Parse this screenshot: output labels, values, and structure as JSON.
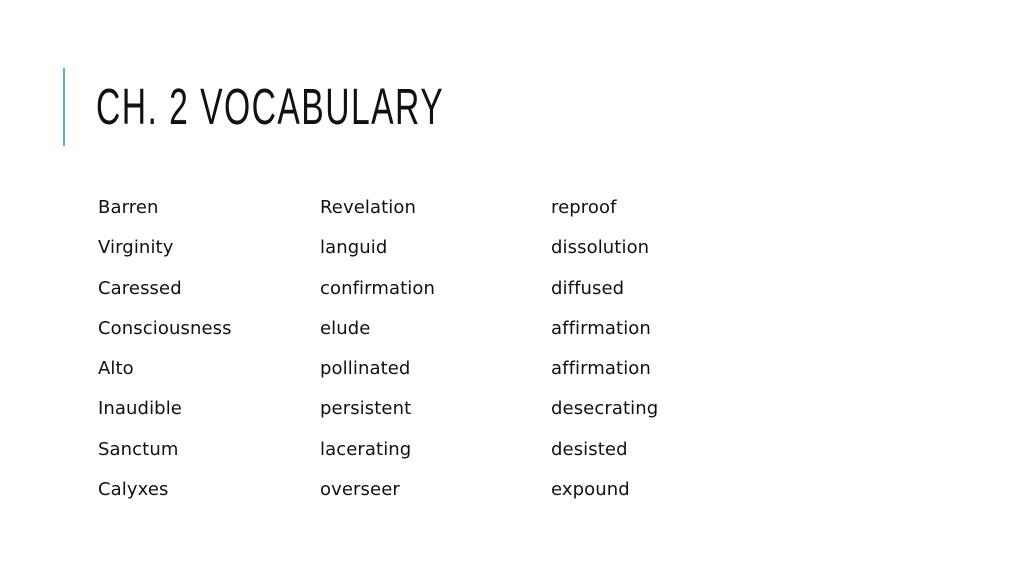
{
  "slide": {
    "title": "Ch. 2 Vocabulary",
    "accent_color": "#4fb8c8"
  },
  "vocabulary": {
    "columns": [
      {
        "words": [
          "Barren",
          "Virginity",
          "Caressed",
          "Consciousness",
          "Alto",
          "Inaudible",
          "Sanctum",
          "Calyxes"
        ]
      },
      {
        "words": [
          "Revelation",
          "languid",
          "confirmation",
          "elude",
          "pollinated",
          "persistent",
          "lacerating",
          "overseer"
        ]
      },
      {
        "words": [
          "reproof",
          "dissolution",
          "diffused",
          "affirmation",
          "affirmation",
          "desecrating",
          "desisted",
          "expound"
        ]
      }
    ]
  }
}
